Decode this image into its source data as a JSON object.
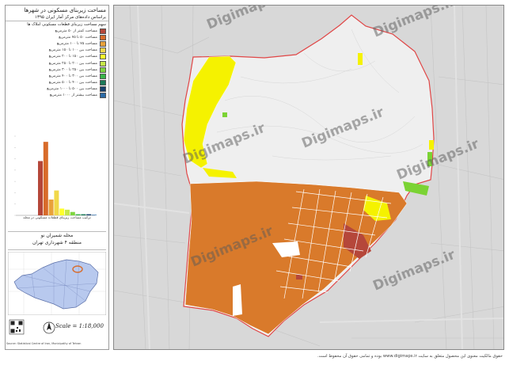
{
  "legend": {
    "title": "مساحت زیربنای مسکونی در شهرها",
    "subtitle": "براساس داده‌های مرکز آمار ایران ۱۳۹۵",
    "heading": "سهم مساحت زیربنای قطعات مسکونی املاک ها",
    "classes": [
      {
        "label": "مساحت کمتر از ۵۰ مترمربع",
        "color": "#b5473a"
      },
      {
        "label": "مساحت ۵۰ تا ۷۵ مترمربع",
        "color": "#d86b2a"
      },
      {
        "label": "مساحت ۷۵ تا ۱۰۰ مترمربع",
        "color": "#e9a23b"
      },
      {
        "label": "مساحت بین ۱۰۰ تا ۱۵۰ مترمربع",
        "color": "#f1d84a"
      },
      {
        "label": "مساحت بین ۱۵۰ تا ۲۰۰ مترمربع",
        "color": "#ffff2a"
      },
      {
        "label": "مساحت بین ۲۰۰ تا ۲۵۰ مترمربع",
        "color": "#c7e84a"
      },
      {
        "label": "مساحت بین ۲۵۰ تا ۳۰۰ مترمربع",
        "color": "#7ed640"
      },
      {
        "label": "مساحت بین ۳۰۰ تا ۴۰۰ مترمربع",
        "color": "#39b54a"
      },
      {
        "label": "مساحت بین ۴۰۰ تا ۵۰۰ مترمربع",
        "color": "#1c7a5a"
      },
      {
        "label": "مساحت بین ۵۰۰ تا ۱۰۰۰ مترمربع",
        "color": "#17416e"
      },
      {
        "label": "مساحت بیشتر از ۱۰۰۰ مترمربع",
        "color": "#2b6aa6"
      }
    ]
  },
  "chart_caption": "ترکیب مساحت زیربنای قطعات مسکونی در محله",
  "district": {
    "name": "محله شمیران نو",
    "region": "منطقه ۴ شهرداری تهران"
  },
  "scale_label": "Scale = 1:18,000",
  "north_label": "N",
  "source_note": "Source: Statistical Centre of Iran, Municipality of Tehran",
  "footer": "حقوق مالکیت معنوی این محصول متعلق به سایت www.digimaps.ir بوده و تمامی حقوق آن محفوظ است.",
  "watermark_text": "Digimaps.ir",
  "colors": {
    "residential_orange": "#d97a2b",
    "light_gray_zone": "#efefef",
    "yellow_zone": "#f5f200",
    "green_zone": "#7bd334",
    "boundary": "#e04646",
    "dark_red": "#b5473a",
    "basemap": "#d8d8d8"
  },
  "chart_data": {
    "type": "bar",
    "values": [
      48,
      65,
      14,
      22,
      6,
      5,
      3,
      1,
      1,
      1,
      0.5
    ]
  }
}
